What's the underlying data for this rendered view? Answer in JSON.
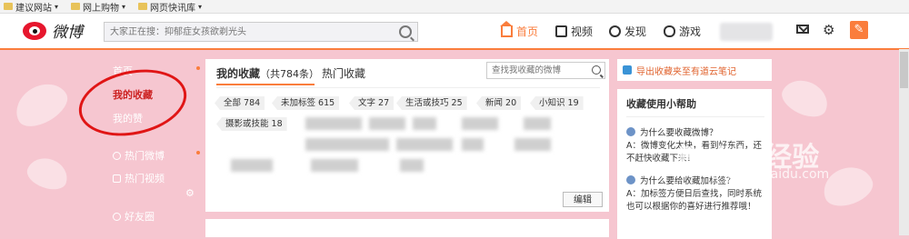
{
  "bookmarks": [
    {
      "label": "建议网站",
      "caret": "▾"
    },
    {
      "label": "网上购物",
      "caret": "▾"
    },
    {
      "label": "网页快讯库",
      "caret": "▾"
    }
  ],
  "header": {
    "logo_text": "微博",
    "search_placeholder": "大家正在搜：抑郁症女孩欲剃光头",
    "nav": {
      "home": "首页",
      "video": "视频",
      "discover": "发现",
      "game": "游戏"
    },
    "compose_glyph": "✎",
    "gear_glyph": "⚙"
  },
  "sidebar": {
    "items": [
      {
        "label": "首页"
      },
      {
        "label": "我的收藏"
      },
      {
        "label": "我的赞"
      },
      {
        "label": "热门微博"
      },
      {
        "label": "热门视频"
      },
      {
        "label": "好友圈"
      }
    ],
    "gear_glyph": "⚙"
  },
  "favorites": {
    "tab_mine": "我的收藏",
    "tab_mine_count": "（共784条）",
    "tab_hot": "热门收藏",
    "search_placeholder": "查找我收藏的微博",
    "tags": [
      {
        "label": "全部 784"
      },
      {
        "label": "未加标签 615"
      },
      {
        "label": "文字 27"
      },
      {
        "label": "生活或技巧 25"
      },
      {
        "label": "新闻 20"
      },
      {
        "label": "小知识 19"
      },
      {
        "label": "摄影或技能 18"
      }
    ],
    "edit_label": "编辑"
  },
  "right_panel": {
    "export_label": "导出收藏夹至有道云笔记",
    "help_title": "收藏使用小帮助",
    "qa": [
      {
        "q": "为什么要收藏微博？",
        "a": "A：微博变化太快，看到好东西，还不赶快收藏下来！"
      },
      {
        "q": "为什么要给收藏加标签？",
        "a": "A：加标签方便日后查找，同时系统也可以根据你的喜好进行推荐哦！"
      }
    ]
  },
  "watermark": {
    "main": "Baidu经验",
    "sub": "jingyan.baidu.com"
  },
  "colors": {
    "accent": "#fa7d3c",
    "brand_red": "#e6162d",
    "annotation_red": "#e01515",
    "page_bg": "#f6c6d0"
  }
}
